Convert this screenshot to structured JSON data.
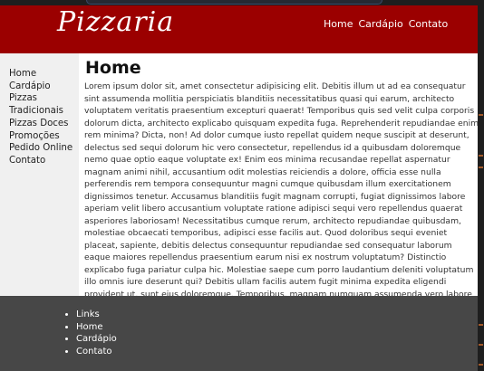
{
  "header": {
    "logo": "Pizzaria",
    "nav": [
      "Home",
      "Cardápio",
      "Contato"
    ]
  },
  "sidebar": {
    "items": [
      "Home",
      "Cardápio",
      "Pizzas",
      "Tradicionais",
      "Pizzas Doces",
      "Promoções",
      "Pedido Online",
      "Contato"
    ]
  },
  "main": {
    "title": "Home",
    "text": "Lorem ipsum dolor sit, amet consectetur adipisicing elit. Debitis illum ut ad ea consequatur sint assumenda mollitia perspiciatis blanditiis necessitatibus quasi qui earum, architecto voluptatem veritatis praesentium excepturi quaerat! Temporibus quis sed velit culpa corporis dolorum dicta, architecto explicabo quisquam expedita fuga. Reprehenderit repudiandae enim rem minima? Dicta, non! Ad dolor cumque iusto repellat quidem neque suscipit at deserunt, delectus sed sequi dolorum hic vero consectetur, repellendus id a quibusdam doloremque nemo quae optio eaque voluptate ex! Enim eos minima recusandae repellat aspernatur magnam animi nihil, accusantium odit molestias reiciendis a dolore, officia esse nulla perferendis rem tempora consequuntur magni cumque quibusdam illum exercitationem dignissimos tenetur. Accusamus blanditiis fugit magnam corrupti, fugiat dignissimos labore aperiam velit libero accusantium voluptate ratione adipisci sequi vero repellendus quaerat asperiores laboriosam! Necessitatibus cumque rerum, architecto repudiandae quibusdam, molestiae obcaecati temporibus, adipisci esse facilis aut. Quod doloribus sequi eveniet placeat, sapiente, debitis delectus consequuntur repudiandae sed consequatur laborum eaque maiores repellendus praesentium earum nisi ex nostrum voluptatum? Distinctio explicabo fuga pariatur culpa hic. Molestiae saepe cum porro laudantium deleniti voluptatum illo omnis iure deserunt qui? Debitis ullam facilis autem fugit minima expedita eligendi provident ut, sunt eius doloremque. Temporibus, magnam numquam assumenda vero labore quidem."
  },
  "footer": {
    "links": [
      "Links",
      "Home",
      "Cardápio",
      "Contato"
    ]
  },
  "colors": {
    "header_bg": "#9b0000",
    "sidebar_bg": "#f0f0f0",
    "footer_bg": "#474747",
    "editor_bg": "#1e1e1e"
  }
}
